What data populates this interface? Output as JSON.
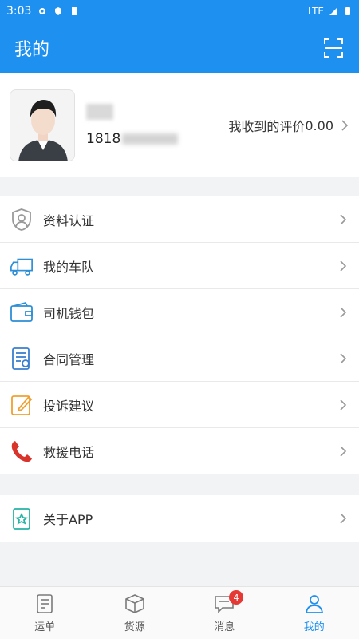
{
  "status": {
    "time": "3:03",
    "network": "LTE"
  },
  "header": {
    "title": "我的"
  },
  "profile": {
    "name_visible": "",
    "phone_visible": "1818",
    "rating_label": "我收到的评价",
    "rating_value": "0.00"
  },
  "menu": [
    {
      "label": "资料认证",
      "icon": "id-verify-icon"
    },
    {
      "label": "我的车队",
      "icon": "truck-icon"
    },
    {
      "label": "司机钱包",
      "icon": "wallet-icon"
    },
    {
      "label": "合同管理",
      "icon": "contract-icon"
    },
    {
      "label": "投诉建议",
      "icon": "edit-icon"
    },
    {
      "label": "救援电话",
      "icon": "phone-icon"
    }
  ],
  "menu2": [
    {
      "label": "关于APP",
      "icon": "app-info-icon"
    }
  ],
  "tabs": [
    {
      "label": "运单"
    },
    {
      "label": "货源"
    },
    {
      "label": "消息",
      "badge": "4"
    },
    {
      "label": "我的",
      "active": true
    }
  ],
  "colors": {
    "primary": "#1e90f0",
    "badge": "#e53935",
    "phone_red": "#d9342b",
    "wallet_blue": "#2d8fd6",
    "contract_blue": "#3a7fd0",
    "edit_orange": "#f0a030",
    "teal": "#26b3a6"
  }
}
